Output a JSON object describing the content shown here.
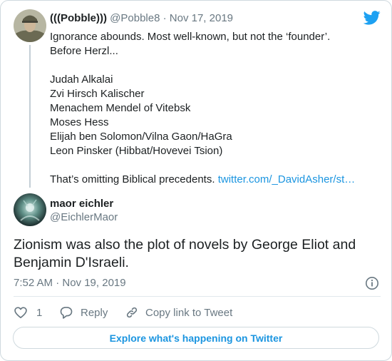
{
  "parent_tweet": {
    "display_name": "(((Pobble)))",
    "handle": "@Pobble8",
    "separator": "·",
    "date": "Nov 17, 2019",
    "lines": [
      "Ignorance abounds. Most well-known, but not the ‘founder’.",
      "Before Herzl...",
      "",
      "Judah Alkalai",
      "Zvi Hirsch Kalischer",
      "Menachem Mendel of Vitebsk",
      "Moses Hess",
      "Elijah ben Solomon/Vilna Gaon/HaGra",
      "Leon Pinsker (Hibbat/Hovevei Tsion)",
      ""
    ],
    "closing_text": "That’s omitting Biblical precedents.",
    "link_text": "twitter.com/_DavidAsher/st…"
  },
  "main_tweet": {
    "display_name": "maor eichler",
    "handle": "@EichlerMaor",
    "text": "Zionism was also the plot of novels by George Eliot and Benjamin D'Israeli.",
    "timestamp": "7:52 AM · Nov 19, 2019"
  },
  "actions": {
    "like_count": "1",
    "reply_label": "Reply",
    "copy_link_label": "Copy link to Tweet"
  },
  "explore_button_label": "Explore what's happening on Twitter",
  "icons": {
    "brand": "twitter-bird-icon",
    "info": "info-icon",
    "like": "heart-icon",
    "reply": "speech-bubble-icon",
    "copy_link": "link-icon"
  },
  "colors": {
    "brand_blue": "#1da1f2",
    "link_blue": "#1b95e0",
    "text": "#1c2022",
    "muted": "#697882",
    "border": "#cfd9de"
  }
}
